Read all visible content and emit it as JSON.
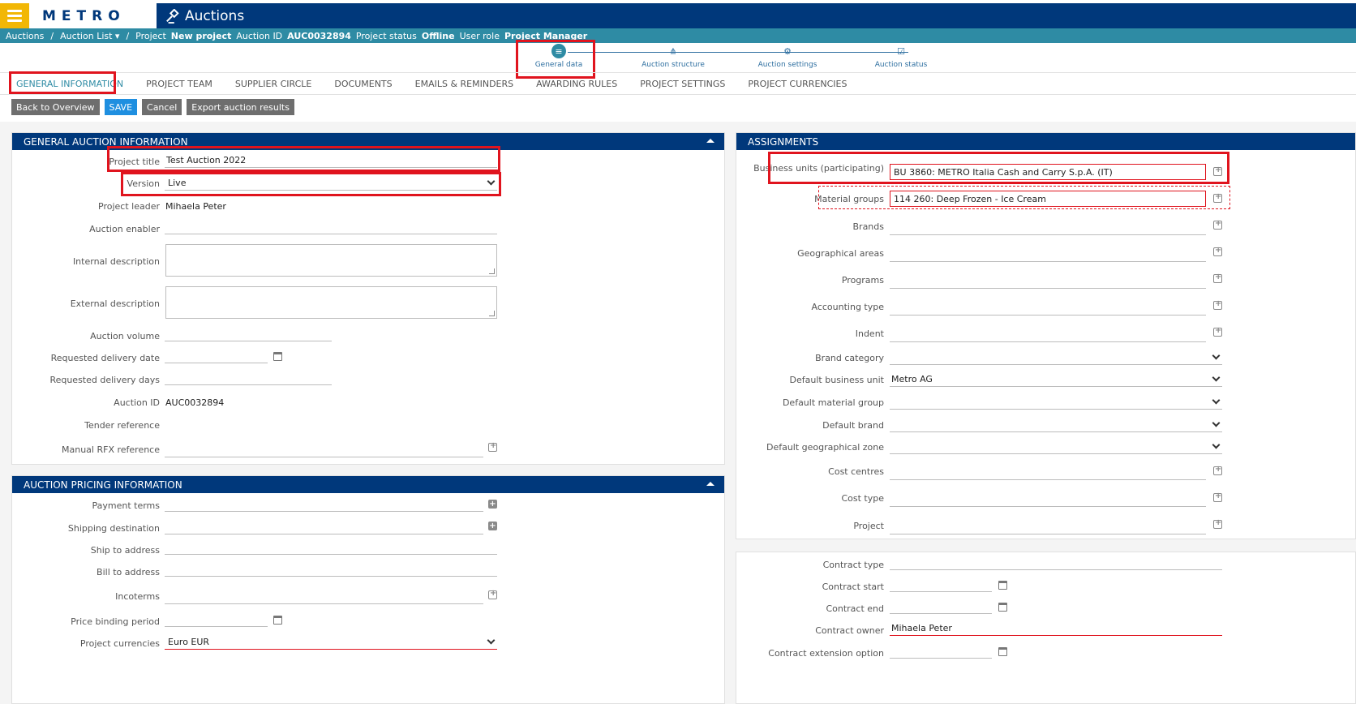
{
  "header": {
    "logo": "METRO",
    "app_title": "Auctions"
  },
  "breadcrumb": {
    "auctions": "Auctions",
    "sep": "/",
    "auction_list": "Auction List ▾",
    "project_label": "Project",
    "project_value": "New project",
    "auction_id_label": "Auction ID",
    "auction_id_value": "AUC0032894",
    "status_label": "Project status",
    "status_value": "Offline",
    "role_label": "User role",
    "role_value": "Project Manager"
  },
  "stepper": {
    "steps": [
      "General data",
      "Auction structure",
      "Auction settings",
      "Auction status"
    ]
  },
  "tabs": [
    "GENERAL INFORMATION",
    "PROJECT TEAM",
    "SUPPLIER CIRCLE",
    "DOCUMENTS",
    "EMAILS & REMINDERS",
    "AWARDING RULES",
    "PROJECT SETTINGS",
    "PROJECT CURRENCIES"
  ],
  "actions": {
    "back": "Back to Overview",
    "save": "SAVE",
    "cancel": "Cancel",
    "export": "Export auction results"
  },
  "general": {
    "title": "GENERAL AUCTION INFORMATION",
    "labels": {
      "project_title": "Project title",
      "version": "Version",
      "project_leader": "Project leader",
      "auction_enabler": "Auction enabler",
      "internal_description": "Internal description",
      "external_description": "External description",
      "auction_volume": "Auction volume",
      "requested_delivery_date": "Requested delivery date",
      "requested_delivery_days": "Requested delivery days",
      "auction_id": "Auction ID",
      "tender_reference": "Tender reference",
      "manual_rfx_reference": "Manual RFX reference"
    },
    "values": {
      "project_title": "Test Auction 2022",
      "version": "Live",
      "project_leader": "Mihaela Peter",
      "auction_id": "AUC0032894"
    }
  },
  "pricing": {
    "title": "AUCTION PRICING INFORMATION",
    "labels": {
      "payment_terms": "Payment terms",
      "shipping_destination": "Shipping destination",
      "ship_to": "Ship to address",
      "bill_to": "Bill to address",
      "incoterms": "Incoterms",
      "price_binding": "Price binding period",
      "project_currencies": "Project currencies"
    },
    "values": {
      "project_currencies": "Euro EUR"
    }
  },
  "assignments": {
    "title": "ASSIGNMENTS",
    "labels": {
      "business_units": "Business units (participating)",
      "material_groups": "Material groups",
      "brands": "Brands",
      "geo_areas": "Geographical areas",
      "programs": "Programs",
      "accounting_type": "Accounting type",
      "indent": "Indent",
      "brand_category": "Brand category",
      "default_bu": "Default business unit",
      "default_mg": "Default material group",
      "default_brand": "Default brand",
      "default_geo": "Default geographical zone",
      "cost_centres": "Cost centres",
      "cost_type": "Cost type",
      "project": "Project"
    },
    "values": {
      "business_units": "BU 3860: METRO Italia Cash and Carry S.p.A. (IT)",
      "material_groups": "114 260: Deep Frozen - Ice Cream",
      "default_bu": "Metro AG"
    }
  },
  "contract": {
    "labels": {
      "contract_type": "Contract type",
      "contract_start": "Contract start",
      "contract_end": "Contract end",
      "contract_owner": "Contract owner",
      "extension": "Contract extension option"
    },
    "values": {
      "contract_owner": "Mihaela Peter"
    }
  },
  "colors": {
    "header": "#00387b",
    "breadcrumb_bar": "#2e8ba4",
    "accent": "#f2b705",
    "highlight": "#e0141e",
    "primary_button": "#1f8fe0"
  }
}
